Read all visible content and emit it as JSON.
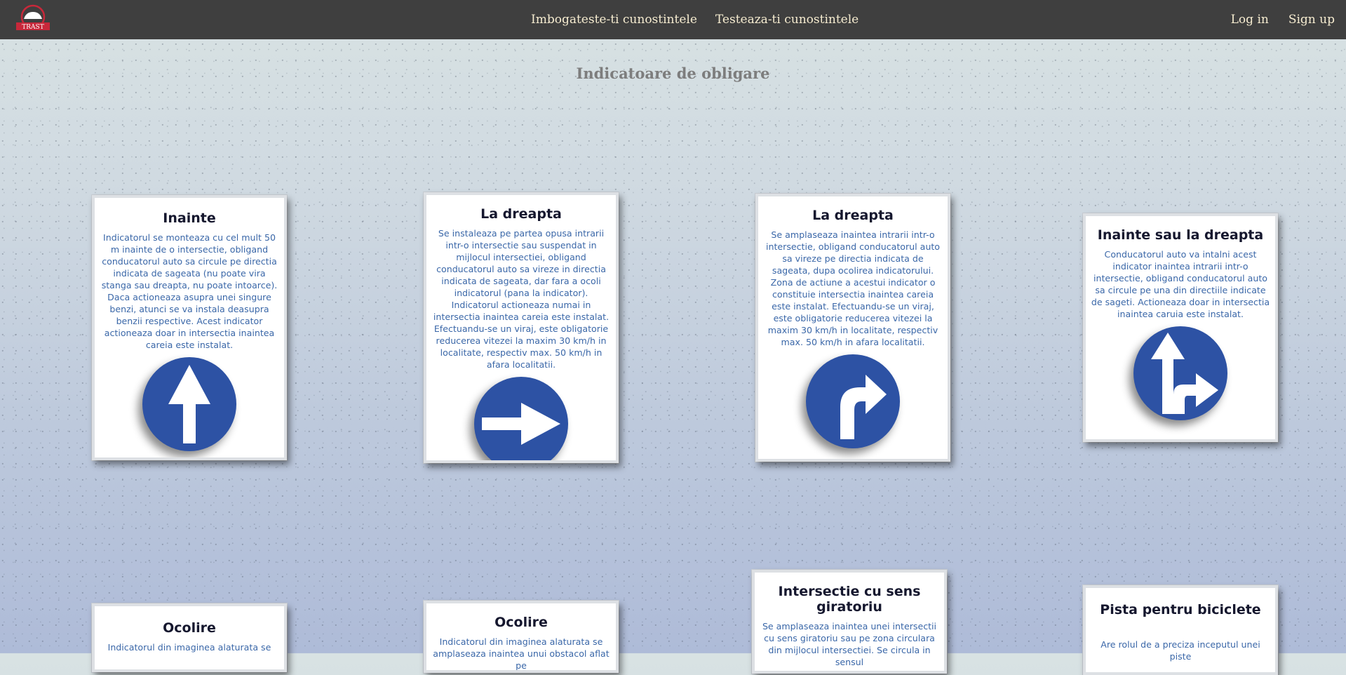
{
  "nav": {
    "logo_text": "TRAST",
    "links_center": [
      "Imbogateste-ti cunostintele",
      "Testeaza-ti cunostintele"
    ],
    "links_right": [
      "Log in",
      "Sign up"
    ]
  },
  "page_title": "Indicatoare de obligare",
  "cards": [
    {
      "title": "Inainte",
      "desc": "Indicatorul se monteaza cu cel mult 50 m inainte de o intersectie, obligand conducatorul auto sa circule pe directia indicata de sageata (nu poate vira stanga sau dreapta, nu poate intoarce). Daca actioneaza asupra unei singure benzi, atunci se va instala deasupra benzii respective. Acest indicator actioneaza doar in intersectia inaintea careia este instalat.",
      "sign": "straight-arrow-icon"
    },
    {
      "title": "La dreapta",
      "desc": "Se instaleaza pe partea opusa intrarii intr-o intersectie sau suspendat in mijlocul intersectiei, obligand conducatorul auto sa vireze in directia indicata de sageata, dar fara a ocoli indicatorul (pana la indicator). Indicatorul actioneaza numai in intersectia inaintea careia este instalat. Efectuandu-se un viraj, este obligatorie reducerea vitezei la maxim 30 km/h in localitate, respectiv max. 50 km/h in afara localitatii.",
      "sign": "right-arrow-icon"
    },
    {
      "title": "La dreapta",
      "desc": "Se amplaseaza inaintea intrarii intr-o intersectie, obligand conducatorul auto sa vireze pe directia indicata de sageata, dupa ocolirea indicatorului. Zona de actiune a acestui indicator o constituie intersectia inaintea careia este instalat. Efectuandu-se un viraj, este obligatorie reducerea vitezei la maxim 30 km/h in localitate, respectiv max. 50 km/h in afara localitatii.",
      "sign": "turn-right-arrow-icon"
    },
    {
      "title": "Inainte sau la dreapta",
      "desc": "Conducatorul auto va intalni acest indicator inaintea intrarii intr-o intersectie, obligand conducatorul auto sa circule pe una din directiile indicate de sageti. Actioneaza doar in intersectia inaintea caruia este instalat.",
      "sign": "straight-or-right-arrow-icon"
    },
    {
      "title": "Ocolire",
      "desc": "Indicatorul din imaginea alaturata se"
    },
    {
      "title": "Ocolire",
      "desc": "Indicatorul din imaginea alaturata se amplaseaza inaintea unui obstacol aflat pe"
    },
    {
      "title": "Intersectie cu sens giratoriu",
      "desc": "Se amplaseaza inaintea unei intersectii cu sens giratoriu sau pe zona circulara din mijlocul intersectiei. Se circula in sensul"
    },
    {
      "title": "Pista pentru biciclete",
      "desc": "Are rolul de a preciza inceputul unei piste"
    }
  ],
  "colors": {
    "sign_blue": "#2d52a4",
    "nav_bg": "#3f3f3f",
    "nav_text": "#f6ecd0",
    "desc_text": "#3a67a8"
  }
}
